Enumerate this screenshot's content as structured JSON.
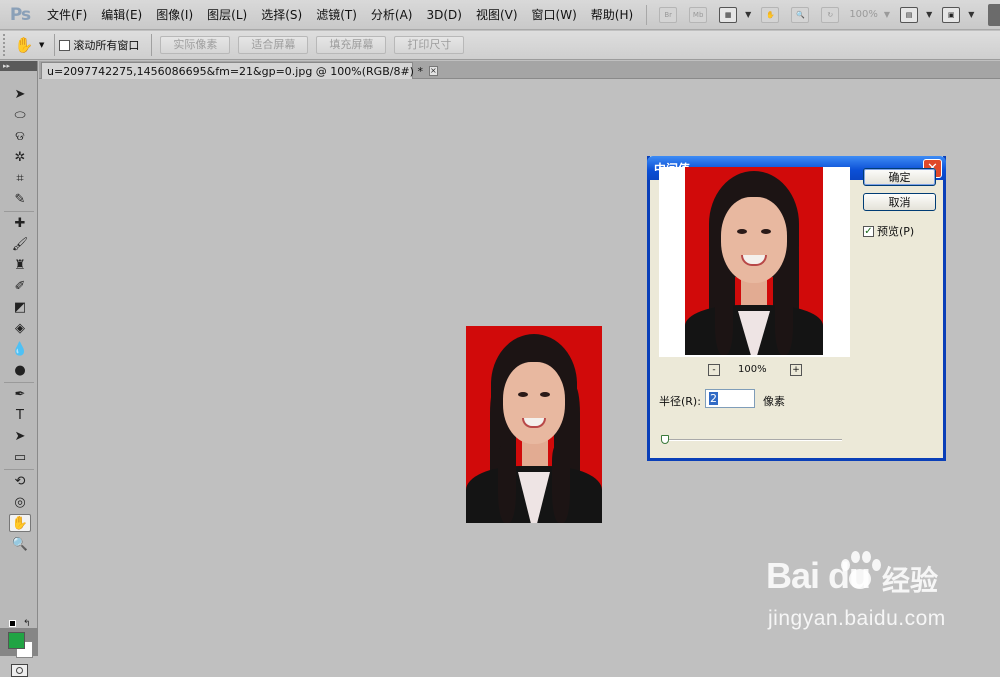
{
  "app": {
    "logo": "Ps"
  },
  "menu": [
    "文件(F)",
    "编辑(E)",
    "图像(I)",
    "图层(L)",
    "选择(S)",
    "滤镜(T)",
    "分析(A)",
    "3D(D)",
    "视图(V)",
    "窗口(W)",
    "帮助(H)"
  ],
  "menubar_tools": {
    "br_label": "Br",
    "mb_label": "Mb",
    "zoom": "100%"
  },
  "options_bar": {
    "scroll_all_label": "滚动所有窗口",
    "buttons": [
      "实际像素",
      "适合屏幕",
      "填充屏幕",
      "打印尺寸"
    ]
  },
  "document": {
    "tab_title": "u=2097742275,1456086695&fm=21&gp=0.jpg @ 100%(RGB/8#) *",
    "close_glyph": "×"
  },
  "dialog": {
    "title": "中间值",
    "ok_label": "确定",
    "cancel_label": "取消",
    "preview_label": "预览(P)",
    "preview_checked": true,
    "zoom_out": "-",
    "zoom_in": "+",
    "zoom_level": "100%",
    "radius_label": "半径(R):",
    "radius_value": "2",
    "radius_unit": "像素"
  },
  "watermark": {
    "logo_text": "Bai  du",
    "cn_text": "经验",
    "url": "jingyan.baidu.com"
  },
  "colors": {
    "foreground": "#21a444",
    "background": "#ffffff",
    "photo_bg": "#d10a0a",
    "dialog_title": "#0b4fd6"
  }
}
